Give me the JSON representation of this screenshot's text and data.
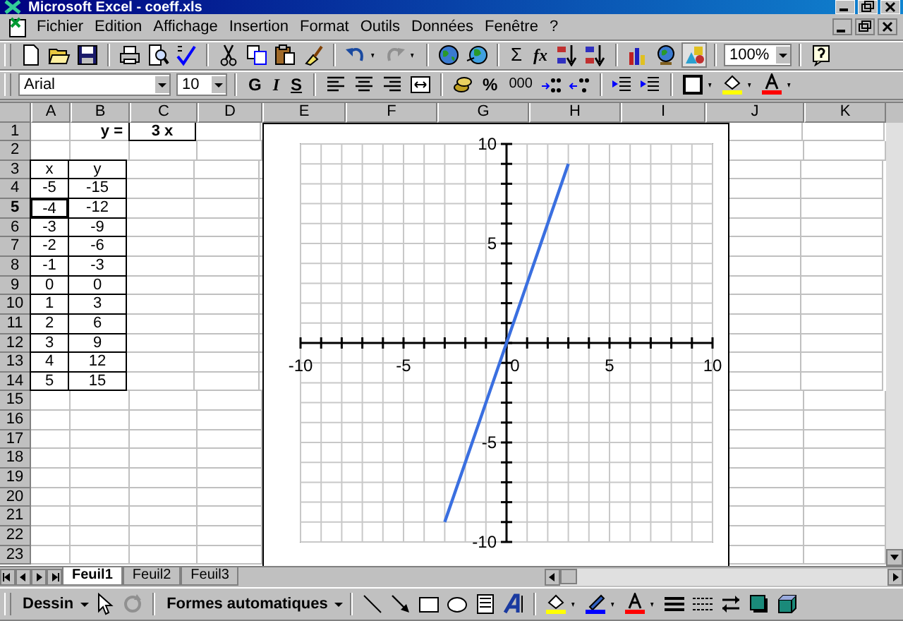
{
  "window": {
    "title": "Microsoft Excel - coeff.xls"
  },
  "menu": [
    {
      "label": "Fichier"
    },
    {
      "label": "Edition"
    },
    {
      "label": "Affichage"
    },
    {
      "label": "Insertion"
    },
    {
      "label": "Format"
    },
    {
      "label": "Outils"
    },
    {
      "label": "Données"
    },
    {
      "label": "Fenêtre"
    },
    {
      "label": "?"
    }
  ],
  "standard": {
    "sum": "Σ",
    "function": "fx",
    "zoom": "100%"
  },
  "formatting": {
    "font": "Arial",
    "size": "10",
    "bold": "G",
    "italic": "I",
    "underline": "S",
    "percent": "%",
    "thousands": "000"
  },
  "sheet": {
    "columns": [
      "A",
      "B",
      "C",
      "D",
      "E",
      "F",
      "G",
      "H",
      "I",
      "J",
      "K"
    ],
    "rows": [
      {
        "header": "1",
        "selected": false,
        "cells": [
          {
            "text": "",
            "boxed": false,
            "selected": false
          },
          {
            "text": "y =",
            "bold": true,
            "boxed": false,
            "selected": false
          },
          {
            "text": "3  x",
            "bold": true,
            "boxed": true,
            "selected": false
          }
        ]
      },
      {
        "header": "2",
        "selected": false,
        "cells": []
      },
      {
        "header": "3",
        "selected": false,
        "cells": [
          {
            "text": "x",
            "boxed": true,
            "selected": false
          },
          {
            "text": "y",
            "boxed": true,
            "selected": false
          }
        ]
      },
      {
        "header": "4",
        "selected": false,
        "cells": [
          {
            "text": "-5",
            "boxed": true,
            "selected": false
          },
          {
            "text": "-15",
            "boxed": true,
            "selected": false
          }
        ]
      },
      {
        "header": "5",
        "selected": true,
        "cells": [
          {
            "text": "-4",
            "boxed": true,
            "selected": true
          },
          {
            "text": "-12",
            "boxed": true,
            "selected": false
          }
        ]
      },
      {
        "header": "6",
        "selected": false,
        "cells": [
          {
            "text": "-3",
            "boxed": true,
            "selected": false
          },
          {
            "text": "-9",
            "boxed": true,
            "selected": false
          }
        ]
      },
      {
        "header": "7",
        "selected": false,
        "cells": [
          {
            "text": "-2",
            "boxed": true,
            "selected": false
          },
          {
            "text": "-6",
            "boxed": true,
            "selected": false
          }
        ]
      },
      {
        "header": "8",
        "selected": false,
        "cells": [
          {
            "text": "-1",
            "boxed": true,
            "selected": false
          },
          {
            "text": "-3",
            "boxed": true,
            "selected": false
          }
        ]
      },
      {
        "header": "9",
        "selected": false,
        "cells": [
          {
            "text": "0",
            "boxed": true,
            "selected": false
          },
          {
            "text": "0",
            "boxed": true,
            "selected": false
          }
        ]
      },
      {
        "header": "10",
        "selected": false,
        "cells": [
          {
            "text": "1",
            "boxed": true,
            "selected": false
          },
          {
            "text": "3",
            "boxed": true,
            "selected": false
          }
        ]
      },
      {
        "header": "11",
        "selected": false,
        "cells": [
          {
            "text": "2",
            "boxed": true,
            "selected": false
          },
          {
            "text": "6",
            "boxed": true,
            "selected": false
          }
        ]
      },
      {
        "header": "12",
        "selected": false,
        "cells": [
          {
            "text": "3",
            "boxed": true,
            "selected": false
          },
          {
            "text": "9",
            "boxed": true,
            "selected": false
          }
        ]
      },
      {
        "header": "13",
        "selected": false,
        "cells": [
          {
            "text": "4",
            "boxed": true,
            "selected": false
          },
          {
            "text": "12",
            "boxed": true,
            "selected": false
          }
        ]
      },
      {
        "header": "14",
        "selected": false,
        "cells": [
          {
            "text": "5",
            "boxed": true,
            "selected": false
          },
          {
            "text": "15",
            "boxed": true,
            "selected": false
          }
        ]
      },
      {
        "header": "15",
        "selected": false,
        "cells": []
      },
      {
        "header": "16",
        "selected": false,
        "cells": []
      },
      {
        "header": "17",
        "selected": false,
        "cells": []
      },
      {
        "header": "18",
        "selected": false,
        "cells": []
      },
      {
        "header": "19",
        "selected": false,
        "cells": []
      },
      {
        "header": "20",
        "selected": false,
        "cells": []
      },
      {
        "header": "21",
        "selected": false,
        "cells": []
      },
      {
        "header": "22",
        "selected": false,
        "cells": []
      },
      {
        "header": "23",
        "selected": false,
        "cells": []
      }
    ],
    "chart_data": {
      "type": "line",
      "grid": true,
      "x": [
        -3,
        -2,
        -1,
        0,
        1,
        2,
        3
      ],
      "series": [
        {
          "color": "#3a6fe0",
          "values": [
            -9,
            -6,
            -3,
            0,
            3,
            6,
            9
          ]
        }
      ],
      "xlim": [
        -10,
        10
      ],
      "ylim": [
        -10,
        10
      ],
      "xticks": [
        -10,
        -5,
        0,
        5,
        10
      ],
      "yticks": [
        -10,
        -5,
        5,
        10
      ]
    }
  },
  "tabs": [
    {
      "label": "Feuil1",
      "selected": true
    },
    {
      "label": "Feuil2",
      "selected": false
    },
    {
      "label": "Feuil3",
      "selected": false
    }
  ],
  "drawing": {
    "menu": "Dessin",
    "autoshapes": "Formes automatiques"
  }
}
